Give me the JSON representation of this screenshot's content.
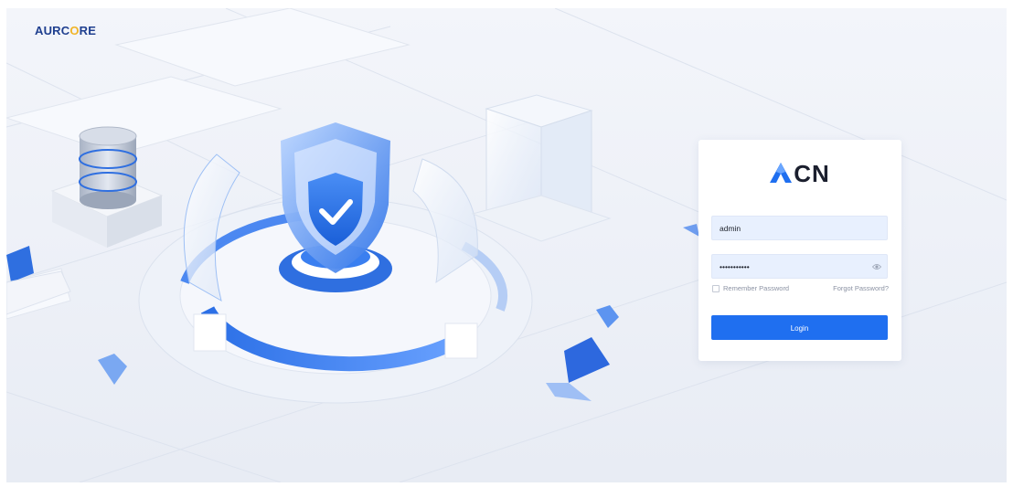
{
  "brand": {
    "name_part1": "AURC",
    "name_o": "O",
    "name_part2": "RE",
    "accent_color": "#f0b428"
  },
  "login_card": {
    "logo_text": "CN",
    "username_value": "admin",
    "password_value": "•••••••••••",
    "remember_label": "Remember Password",
    "forgot_label": "Forgot Password?",
    "login_label": "Login",
    "primary_color": "#1f6ff0",
    "eye_icon": "eye-icon"
  },
  "illustration": {
    "icons": [
      "shield-check-icon",
      "database-icon",
      "glass-cube-icon",
      "diamond-icon"
    ]
  }
}
